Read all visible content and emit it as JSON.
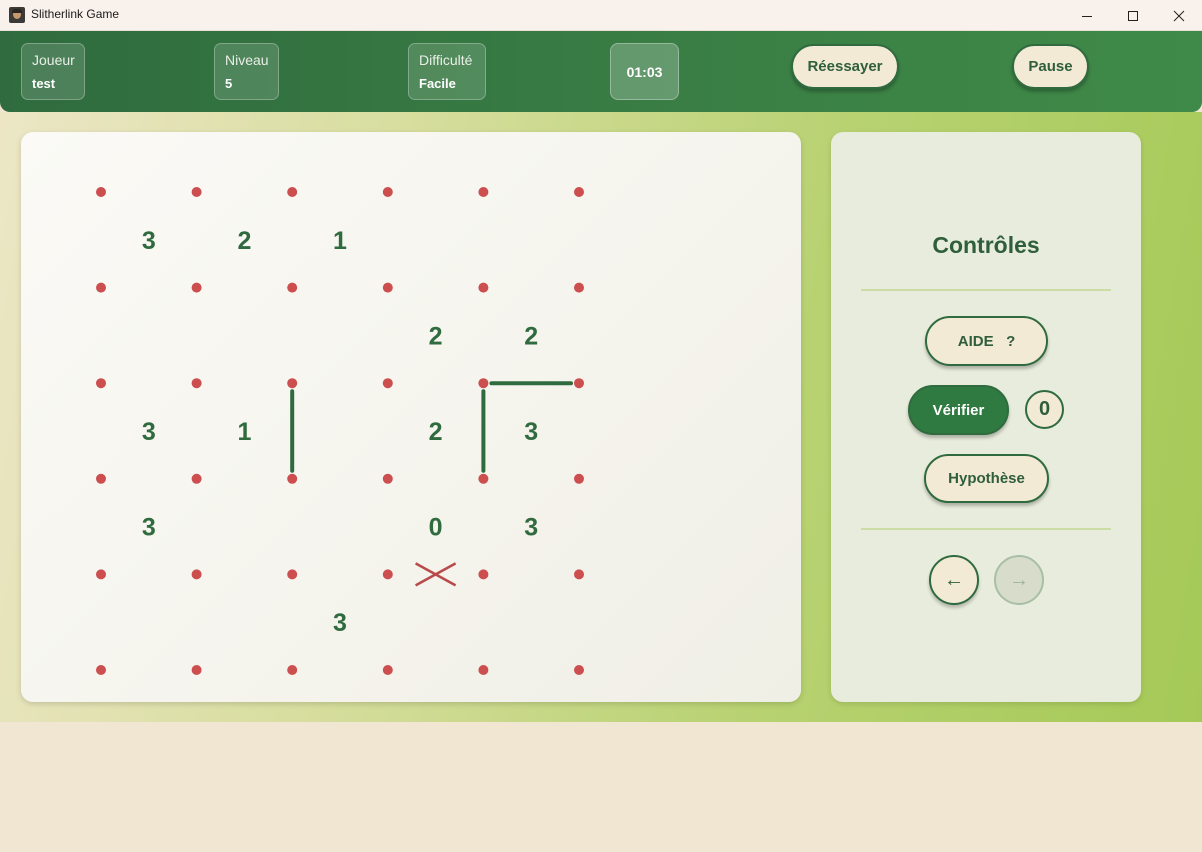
{
  "window": {
    "title": "Slitherlink Game"
  },
  "header": {
    "player": {
      "label": "Joueur",
      "value": "test"
    },
    "level": {
      "label": "Niveau",
      "value": "5"
    },
    "difficulty": {
      "label": "Difficulté",
      "value": "Facile"
    },
    "timer": "01:03",
    "retry_label": "Réessayer",
    "pause_label": "Pause"
  },
  "board": {
    "dot_color": "#cc4e4f",
    "line_color": "#2f6b3e",
    "cross_color": "#b84a4a",
    "clues": [
      [
        3,
        2,
        1,
        null,
        null
      ],
      [
        null,
        null,
        null,
        2,
        2
      ],
      [
        3,
        1,
        null,
        2,
        3
      ],
      [
        3,
        null,
        null,
        0,
        3
      ],
      [
        null,
        null,
        3,
        null,
        null
      ]
    ],
    "drawn_edges": [
      {
        "type": "h",
        "row": 2,
        "col": 4
      },
      {
        "type": "v",
        "row": 2,
        "col": 2
      },
      {
        "type": "v",
        "row": 2,
        "col": 4
      }
    ],
    "crossed_edges": [
      {
        "type": "h",
        "row": 4,
        "col": 3
      }
    ]
  },
  "controls": {
    "title": "Contrôles",
    "help_label": "AIDE   ?",
    "verify_label": "Vérifier",
    "verify_count": "0",
    "hypothesis_label": "Hypothèse",
    "undo_glyph": "←",
    "redo_glyph": "→"
  },
  "colors": {
    "header_green": "#2f6b3e",
    "button_cream": "#f3ead6",
    "accent_green": "#2f7a40"
  }
}
